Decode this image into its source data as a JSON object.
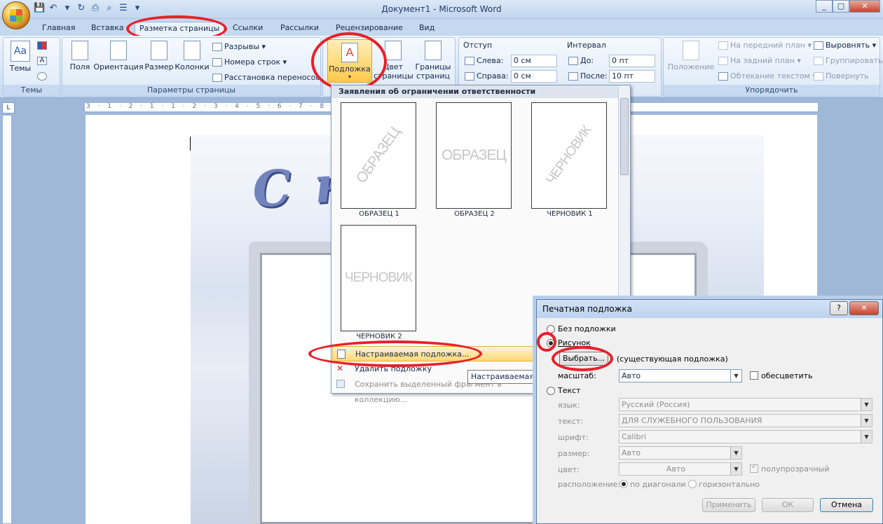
{
  "window": {
    "title": "Документ1 - Microsoft Word",
    "min": "_",
    "max": "▢",
    "close": "✕"
  },
  "tabs": [
    "Главная",
    "Вставка",
    "Разметка страницы",
    "Ссылки",
    "Рассылки",
    "Рецензирование",
    "Вид"
  ],
  "ribbon": {
    "themes": {
      "themes_btn": "Темы",
      "group": "Темы"
    },
    "page_setup": {
      "margins": "Поля",
      "orientation": "Ориентация",
      "size": "Размер",
      "columns": "Колонки",
      "breaks": "Разрывы",
      "line_numbers": "Номера строк",
      "hyphenation": "Расстановка переносов",
      "group": "Параметры страницы"
    },
    "background": {
      "watermark": "Подложка",
      "page_color_1": "Цвет",
      "page_color_2": "страницы",
      "page_borders_1": "Границы",
      "page_borders_2": "страниц"
    },
    "paragraph": {
      "indent": "Отступ",
      "left": "Слева:",
      "left_val": "0 см",
      "right": "Справа:",
      "right_val": "0 см",
      "spacing": "Интервал",
      "before": "До:",
      "before_val": "0 пт",
      "after": "После:",
      "after_val": "10 пт"
    },
    "arrange": {
      "position": "Положение",
      "bring_front": "На передний план",
      "send_back": "На задний план",
      "text_wrap": "Обтекание текстом",
      "align": "Выровнять",
      "group_btn": "Группировать",
      "rotate": "Повернуть",
      "group": "Упорядочить"
    }
  },
  "ruler": {
    "corner": "L",
    "ticks": "3 · 1 · 2 · 1 · 1 · 2 · 3 · 4 · 5 · 6 · 7 · 8 · 9 · 10 · 11 · 12 · 13 · 14 · 15 · 16 · 17 ·"
  },
  "document": {
    "greeting": "С н    ом!"
  },
  "watermark_menu": {
    "header": "Заявления об ограничении ответственности",
    "items": [
      {
        "text": "ОБРАЗЕЦ",
        "caption": "ОБРАЗЕЦ 1"
      },
      {
        "text": "ОБРАЗЕЦ",
        "caption": "ОБРАЗЕЦ 2"
      },
      {
        "text": "ЧЕРНОВИК",
        "caption": "ЧЕРНОВИК 1"
      },
      {
        "text": "ЧЕРНОВИК",
        "caption": "ЧЕРНОВИК 2"
      }
    ],
    "custom": "Настраиваемая подложка...",
    "remove": "Удалить подложку",
    "save": "Сохранить выделенный фрагмент в коллекцию...",
    "tooltip": "Настраиваемая подложка"
  },
  "dialog": {
    "title": "Печатная подложка",
    "help": "?",
    "close": "✕",
    "no_watermark": "Без подложки",
    "picture": "Рисунок",
    "select_btn": "Выбрать...",
    "existing": "(существующая подложка)",
    "scale_label": "масштаб:",
    "scale_val": "Авто",
    "washout": "обесцветить",
    "text_wm": "Текст",
    "lang_label": "язык:",
    "lang_val": "Русский (Россия)",
    "text_label": "текст:",
    "text_val": "ДЛЯ СЛУЖЕБНОГО ПОЛЬЗОВАНИЯ",
    "font_label": "шрифт:",
    "font_val": "Calibri",
    "size_label": "размер:",
    "size_val": "Авто",
    "color_label": "цвет:",
    "color_val": "Авто",
    "semi": "полупрозрачный",
    "layout_label": "расположение:",
    "diagonal": "по диагонали",
    "horizontal": "горизонтально",
    "apply": "Применить",
    "ok": "ОК",
    "cancel": "Отмена"
  },
  "colors": {
    "highlight": "#e8202a",
    "ribbon": "#dbe7f6",
    "accent": "#ffd877"
  }
}
